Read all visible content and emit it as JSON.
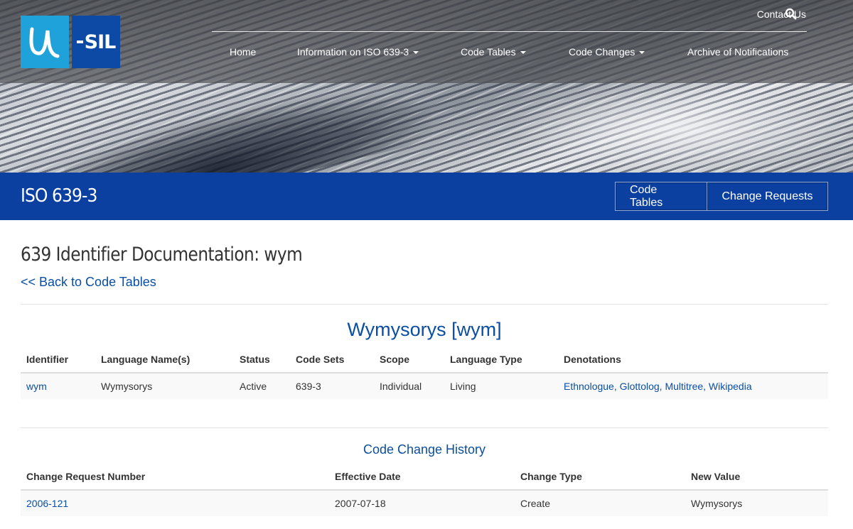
{
  "header": {
    "logo": {
      "mark": "u",
      "text": "SIL"
    },
    "utility": {
      "contact": "Contact Us",
      "search_icon": "search-icon"
    },
    "nav": [
      {
        "label": "Home",
        "has_dropdown": false
      },
      {
        "label": "Information on ISO 639-3",
        "has_dropdown": true
      },
      {
        "label": "Code Tables",
        "has_dropdown": true
      },
      {
        "label": "Code Changes",
        "has_dropdown": true
      },
      {
        "label": "Archive of Notifications",
        "has_dropdown": false
      }
    ]
  },
  "section_bar": {
    "title": "ISO 639-3",
    "buttons": [
      "Code Tables",
      "Change Requests"
    ]
  },
  "page": {
    "title": "639 Identifier Documentation: wym",
    "back_link": "<< Back to Code Tables",
    "language_heading": "Wymysorys [wym]"
  },
  "identifier_table": {
    "headers": [
      "Identifier",
      "Language Name(s)",
      "Status",
      "Code Sets",
      "Scope",
      "Language Type",
      "Denotations"
    ],
    "row": {
      "identifier": "wym",
      "name": "Wymysorys",
      "status": "Active",
      "code_sets": "639-3",
      "scope": "Individual",
      "language_type": "Living",
      "denotations": [
        "Ethnologue",
        "Glottolog",
        "Multitree",
        "Wikipedia"
      ]
    }
  },
  "history": {
    "heading": "Code Change History",
    "headers": [
      "Change Request Number",
      "Effective Date",
      "Change Type",
      "New Value"
    ],
    "row": {
      "request_number": "2006-121",
      "effective_date": "2007-07-18",
      "change_type": "Create",
      "new_value": "Wymysorys"
    }
  },
  "colors": {
    "brand_blue": "#0b3fa0",
    "link_blue": "#0b4ea2",
    "logo_light_blue": "#1fa1d9",
    "logo_dark_blue": "#0c4aa6"
  }
}
